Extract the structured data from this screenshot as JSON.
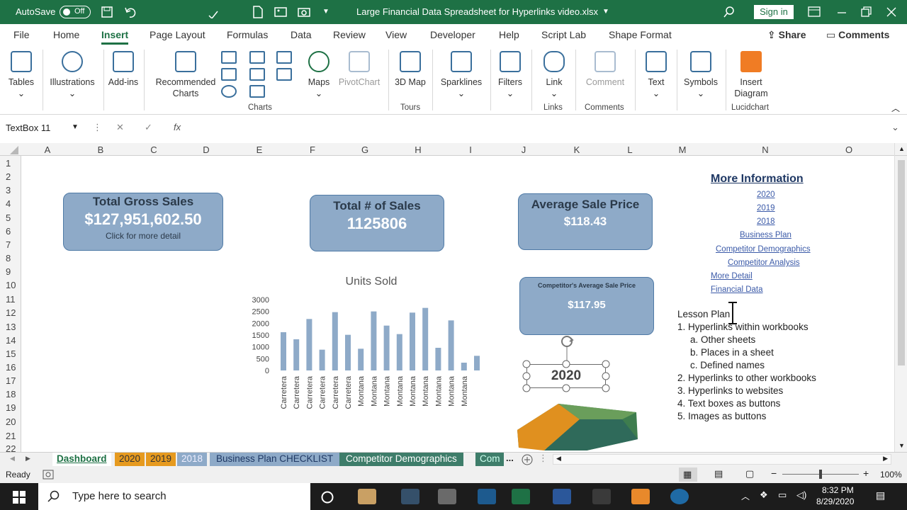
{
  "titlebar": {
    "autosave": "AutoSave",
    "autosave_state": "Off",
    "filename": "Large Financial Data Spreadsheet for Hyperlinks video.xlsx",
    "signin": "Sign in"
  },
  "tabs": [
    "File",
    "Home",
    "Insert",
    "Page Layout",
    "Formulas",
    "Data",
    "Review",
    "View",
    "Developer",
    "Help",
    "Script Lab",
    "Shape Format"
  ],
  "share": "Share",
  "comments": "Comments",
  "ribbon": {
    "tables": "Tables",
    "illustrations": "Illustrations",
    "addins": "Add-ins",
    "recommended_charts": "Recommended Charts",
    "maps": "Maps",
    "pivotchart": "PivotChart",
    "map3d": "3D Map",
    "sparklines": "Sparklines",
    "filters": "Filters",
    "link": "Link",
    "comment": "Comment",
    "text": "Text",
    "symbols": "Symbols",
    "insert_diagram": "Insert Diagram",
    "groups": {
      "charts": "Charts",
      "tours": "Tours",
      "links": "Links",
      "comments": "Comments",
      "lucidchart": "Lucidchart"
    }
  },
  "namebox": "TextBox 11",
  "fx": "fx",
  "columns": [
    "A",
    "B",
    "C",
    "D",
    "E",
    "F",
    "G",
    "H",
    "I",
    "J",
    "K",
    "L",
    "M",
    "N",
    "O"
  ],
  "rows": [
    "1",
    "2",
    "3",
    "4",
    "5",
    "6",
    "7",
    "8",
    "9",
    "10",
    "11",
    "12",
    "13",
    "14",
    "15",
    "16",
    "17",
    "18",
    "19",
    "20",
    "21",
    "22"
  ],
  "kpis": {
    "gross_title": "Total Gross Sales",
    "gross_value": "$127,951,602.50",
    "gross_note": "Click for more detail",
    "count_title": "Total # of Sales",
    "count_value": "1125806",
    "avg_title": "Average Sale Price",
    "avg_value": "$118.43",
    "comp_title": "Competitor's Average Sale Price",
    "comp_value": "$117.95",
    "year_box": "2020"
  },
  "more_info": {
    "title": "More Information",
    "links": [
      "2020",
      "2019",
      "2018",
      "Business Plan",
      "Competitor Demographics",
      "Competitor Analysis",
      "More Detail",
      "Financial Data"
    ]
  },
  "lesson_plan": {
    "title": "Lesson Plan",
    "items": [
      "1. Hyperlinks within workbooks",
      "a. Other sheets",
      "b. Places in a sheet",
      "c. Defined names",
      "2. Hyperlinks to other workbooks",
      "3. Hyperlinks to websites",
      "4. Text boxes as buttons",
      "5. Images as buttons"
    ]
  },
  "chart_data": {
    "type": "bar",
    "title": "Units Sold",
    "categories": [
      "Carretera",
      "Carretera",
      "Carretera",
      "Carretera",
      "Carretera",
      "Carretera",
      "Montana",
      "Montana",
      "Montana",
      "Montana",
      "Montana",
      "Montana",
      "Montana",
      "Montana",
      "Montana"
    ],
    "values": [
      1620,
      1320,
      2180,
      880,
      2470,
      1510,
      920,
      2500,
      1900,
      1540,
      2450,
      2650,
      960,
      2120,
      330,
      620
    ],
    "ylim": [
      0,
      3000
    ],
    "yticks": [
      "3000",
      "2500",
      "2000",
      "1500",
      "1000",
      "500",
      "0"
    ],
    "color": "#8eaac8"
  },
  "sheet_tabs": [
    "Dashboard",
    "2020",
    "2019",
    "2018",
    "Business Plan CHECKLIST",
    "Competitor Demographics",
    "Com"
  ],
  "status": {
    "ready": "Ready",
    "zoom": "100%"
  },
  "taskbar": {
    "search_placeholder": "Type here to search",
    "time": "8:32 PM",
    "date": "8/29/2020"
  }
}
